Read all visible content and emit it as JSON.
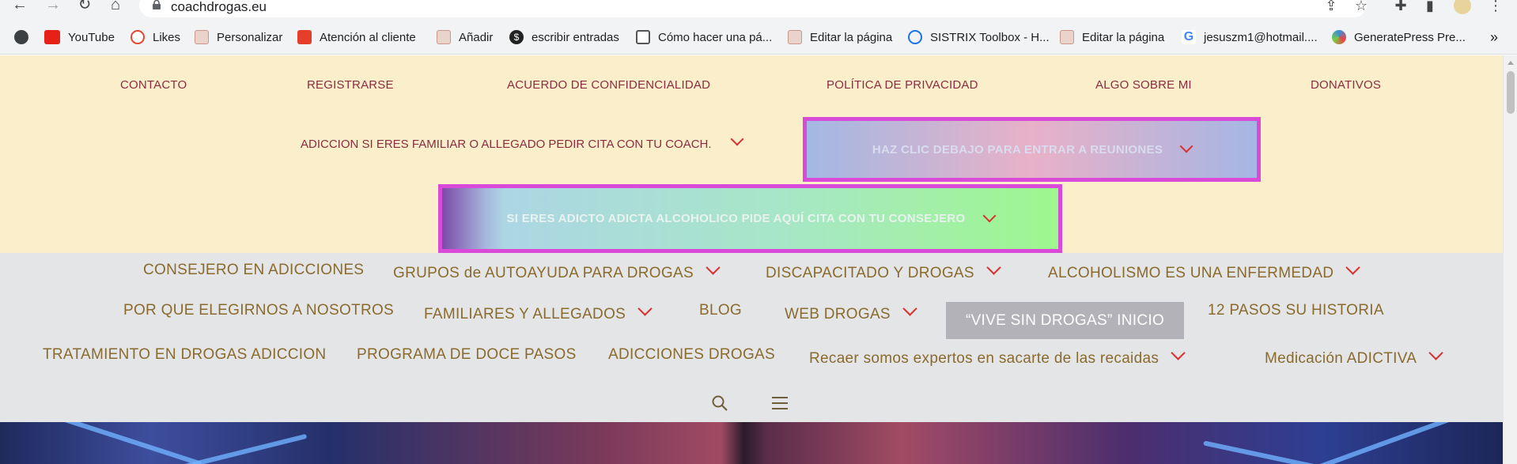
{
  "browser": {
    "url": "coachdrogas.eu",
    "bookmarks": [
      {
        "label": "",
        "icon": "globe-icon"
      },
      {
        "label": "YouTube",
        "icon": "youtube-icon",
        "color": "#e62117"
      },
      {
        "label": "Likes",
        "icon": "likes-icon",
        "color": "#e8452f"
      },
      {
        "label": "Personalizar",
        "icon": "site-icon",
        "color": "#d9a79a"
      },
      {
        "label": "Atención al cliente",
        "icon": "aliexpress-icon",
        "color": "#e53f2b"
      },
      {
        "label": "Añadir",
        "icon": "site-icon",
        "color": "#d9a79a"
      },
      {
        "label": "escribir entradas",
        "icon": "dollar-icon",
        "color": "#222222"
      },
      {
        "label": "Cómo hacer una pá...",
        "icon": "page-icon",
        "color": "#555555"
      },
      {
        "label": "Editar la página",
        "icon": "site-icon",
        "color": "#d9a79a"
      },
      {
        "label": "SISTRIX Toolbox - H...",
        "icon": "magnifier-icon",
        "color": "#1a73e8"
      },
      {
        "label": "Editar la página",
        "icon": "site-icon",
        "color": "#d9a79a"
      },
      {
        "label": "jesuszm1@hotmail....",
        "icon": "google-icon",
        "color": "#4285f4"
      },
      {
        "label": "GeneratePress Pre...",
        "icon": "generatepress-icon",
        "color": "#3a8fd8"
      }
    ],
    "more_bookmarks": "»"
  },
  "topbar": {
    "links": [
      "CONTACTO",
      "REGISTRARSE",
      "ACUERDO DE CONFIDENCIALIDAD",
      "POLÍTICA DE PRIVACIDAD",
      "ALGO SOBRE MI",
      "DONATIVOS"
    ],
    "family_link": "ADICCION SI ERES FAMILIAR O ALLEGADO PEDIR CITA CON TU COACH.",
    "meetings_button": "HAZ CLIC DEBAJO PARA ENTRAR A REUNIONES",
    "addict_button": "SI ERES ADICTO ADICTA ALCOHOLICO PIDE AQUÍ CITA CON TU CONSEJERO"
  },
  "mainnav": {
    "row1": [
      "CONSEJERO EN ADICCIONES",
      "GRUPOS de AUTOAYUDA PARA DROGAS",
      "DISCAPACITADO Y DROGAS",
      "ALCOHOLISMO ES UNA ENFERMEDAD"
    ],
    "row2": [
      "POR QUE ELEGIRNOS A NOSOTROS",
      "FAMILIARES Y ALLEGADOS",
      "BLOG",
      "WEB DROGAS",
      "“VIVE SIN DROGAS” INICIO",
      "12 PASOS SU HISTORIA"
    ],
    "row3": [
      "TRATAMIENTO EN DROGAS ADICCION",
      "PROGRAMA DE DOCE PASOS",
      "ADICCIONES DROGAS",
      "Recaer somos expertos en sacarte de las recaidas",
      "Medicación ADICTIVA"
    ]
  }
}
